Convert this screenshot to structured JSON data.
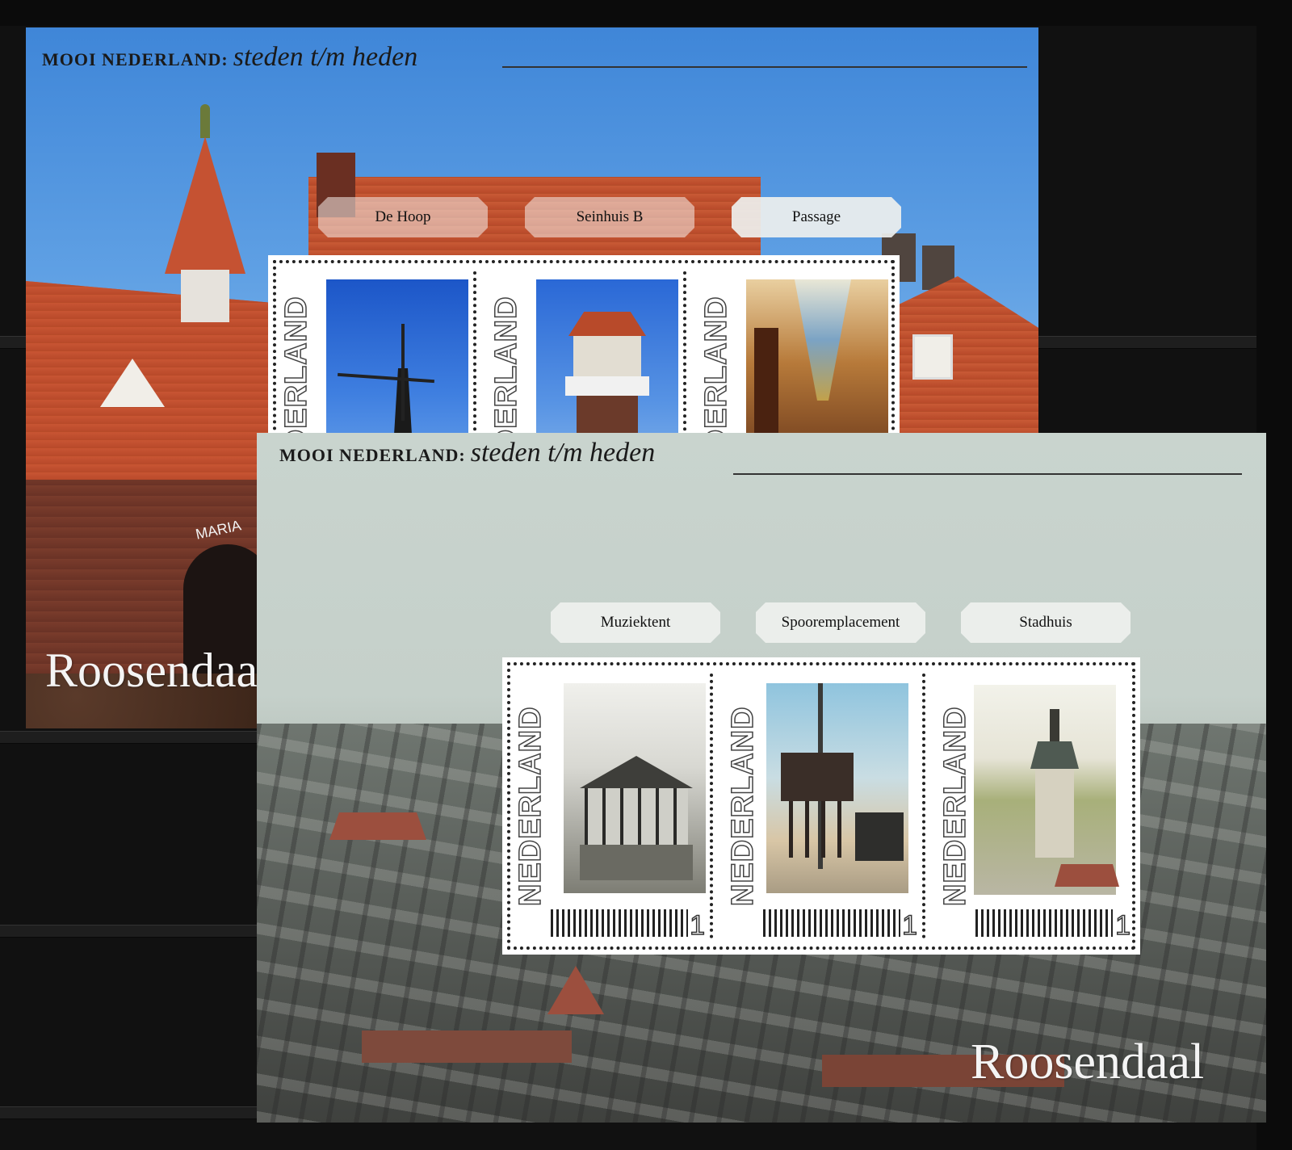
{
  "sheets": [
    {
      "series_caps": "MOOI NEDERLAND:",
      "series_italic": "steden t/m heden",
      "city": "Roosendaal",
      "photo_sign": "MARIA",
      "labels": [
        "De Hoop",
        "Seinhuis B",
        "Passage"
      ],
      "stamps": [
        {
          "country": "NEDERLAND",
          "subject": "windmill"
        },
        {
          "country": "NEDERLAND",
          "subject": "signal-box"
        },
        {
          "country": "NEDERLAND",
          "subject": "passage-arcade"
        }
      ]
    },
    {
      "series_caps": "MOOI NEDERLAND:",
      "series_italic": "steden t/m heden",
      "city": "Roosendaal",
      "labels": [
        "Muziektent",
        "Spooremplacement",
        "Stadhuis"
      ],
      "stamps": [
        {
          "country": "NEDERLAND",
          "value": "1",
          "subject": "bandstand"
        },
        {
          "country": "NEDERLAND",
          "value": "1",
          "subject": "railway-yard"
        },
        {
          "country": "NEDERLAND",
          "value": "1",
          "subject": "town-hall"
        }
      ]
    }
  ],
  "colors": {
    "album_black": "#111111",
    "sheet1_sky": "#4f93de",
    "roof_tile": "#c85533",
    "sheet2_bg": "#c9d4ce"
  }
}
